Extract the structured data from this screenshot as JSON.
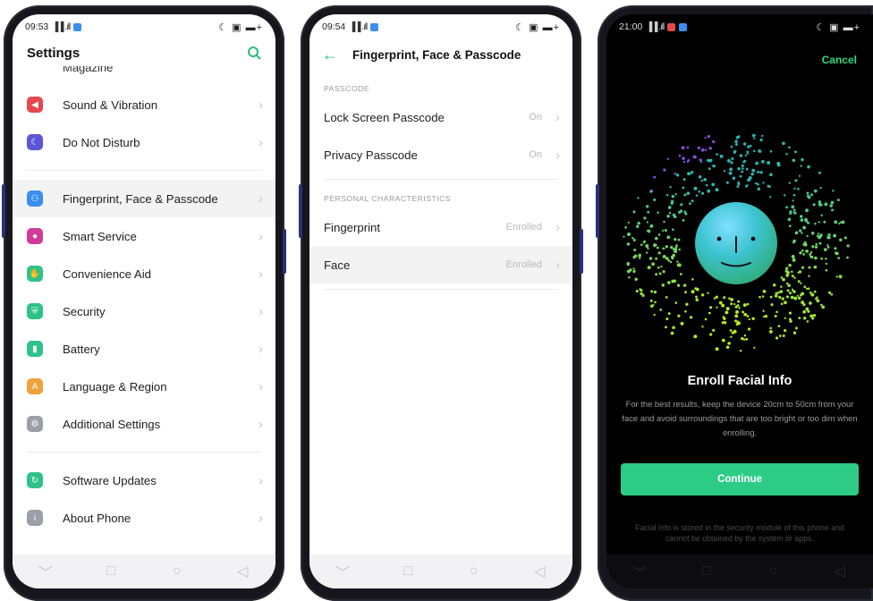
{
  "screen1": {
    "status": {
      "time": "09:53",
      "signal": "▐▐ .ıll",
      "right_icons": "☾ ▣ ▬+"
    },
    "header": {
      "title": "Settings"
    },
    "clipped_item": "Magazine",
    "groups": [
      [
        {
          "label": "Sound & Vibration",
          "icon": "speaker-icon",
          "color": "#e4474c"
        },
        {
          "label": "Do Not Disturb",
          "icon": "moon-icon",
          "color": "#5b57d6"
        }
      ],
      [
        {
          "label": "Fingerprint, Face & Passcode",
          "icon": "face-passcode-icon",
          "color": "#3a8ef0",
          "highlight": true
        },
        {
          "label": "Smart Service",
          "icon": "smart-service-icon",
          "color": "#d23a9a"
        },
        {
          "label": "Convenience Aid",
          "icon": "convenience-icon",
          "color": "#2ec28a"
        },
        {
          "label": "Security",
          "icon": "shield-icon",
          "color": "#2ec28a"
        },
        {
          "label": "Battery",
          "icon": "battery-icon",
          "color": "#2ec28a"
        },
        {
          "label": "Language & Region",
          "icon": "language-icon",
          "color": "#f0a23a"
        },
        {
          "label": "Additional Settings",
          "icon": "gear-icon",
          "color": "#9aa0a8"
        }
      ],
      [
        {
          "label": "Software Updates",
          "icon": "update-icon",
          "color": "#2ec28a"
        },
        {
          "label": "About Phone",
          "icon": "info-icon",
          "color": "#9aa0a8"
        }
      ]
    ]
  },
  "screen2": {
    "status": {
      "time": "09:54",
      "signal": "▐▐ .ıll",
      "right_icons": "☾ ▣ ▬+"
    },
    "header": {
      "title": "Fingerprint, Face & Passcode"
    },
    "sections": [
      {
        "heading": "PASSCODE",
        "rows": [
          {
            "label": "Lock Screen Passcode",
            "value": "On"
          },
          {
            "label": "Privacy Passcode",
            "value": "On"
          }
        ]
      },
      {
        "heading": "PERSONAL CHARACTERISTICS",
        "rows": [
          {
            "label": "Fingerprint",
            "value": "Enrolled"
          },
          {
            "label": "Face",
            "value": "Enrolled",
            "highlight": true
          }
        ]
      }
    ]
  },
  "screen3": {
    "status": {
      "time": "21:00",
      "signal": "▐▐ .ıll",
      "right_icons": "☾ ▣ ▬+"
    },
    "cancel": "Cancel",
    "title": "Enroll Facial Info",
    "description": "For the best results, keep the device 20cm to 50cm from your face and avoid surroundings that are too bright or too dim when enrolling.",
    "continue": "Continue",
    "footnote": "Facial info is stored in the security module of this phone and cannot be obtained by the system or apps."
  },
  "colors": {
    "accent": "#2dbd7b",
    "accent_button": "#2dcc86"
  }
}
